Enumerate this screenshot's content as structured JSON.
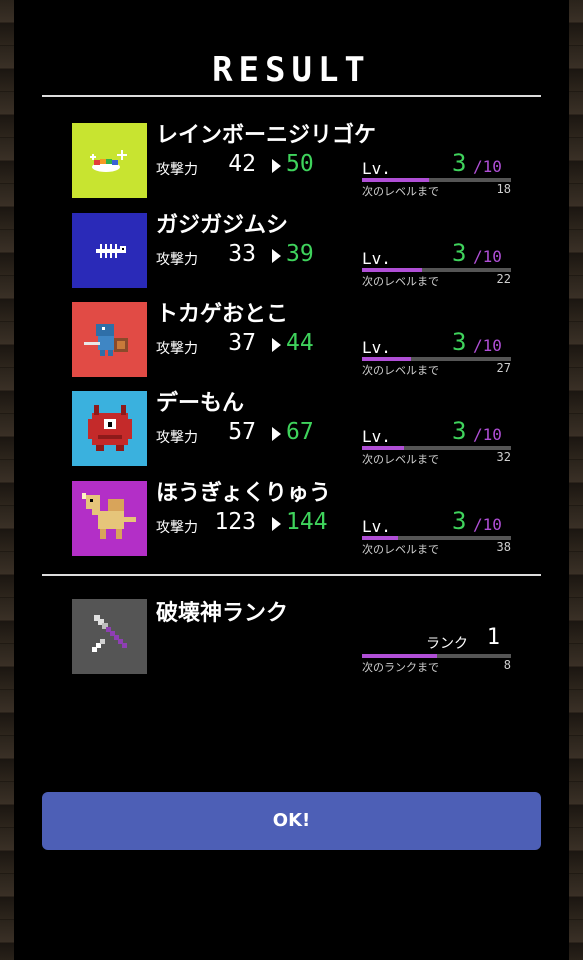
{
  "header": {
    "title": "RESULT"
  },
  "labels": {
    "attack": "攻撃力",
    "level": "Lv.",
    "next_level": "次のレベルまで",
    "rank": "ランク",
    "next_rank": "次のランクまで"
  },
  "monsters": [
    {
      "name": "レインボーニジリゴケ",
      "attack_before": "42",
      "attack_after": "50",
      "level": "3",
      "level_max": "/10",
      "to_next": "18",
      "progress": 0.45,
      "bg": "#c8e430"
    },
    {
      "name": "ガジガジムシ",
      "attack_before": "33",
      "attack_after": "39",
      "level": "3",
      "level_max": "/10",
      "to_next": "22",
      "progress": 0.4,
      "bg": "#2a2ab8"
    },
    {
      "name": "トカゲおとこ",
      "attack_before": "37",
      "attack_after": "44",
      "level": "3",
      "level_max": "/10",
      "to_next": "27",
      "progress": 0.33,
      "bg": "#e14b45"
    },
    {
      "name": "デーもん",
      "attack_before": "57",
      "attack_after": "67",
      "level": "3",
      "level_max": "/10",
      "to_next": "32",
      "progress": 0.28,
      "bg": "#3ab1de"
    },
    {
      "name": "ほうぎょくりゅう",
      "attack_before": "123",
      "attack_after": "144",
      "level": "3",
      "level_max": "/10",
      "to_next": "38",
      "progress": 0.24,
      "bg": "#b32fc7"
    }
  ],
  "rank": {
    "title": "破壊神ランク",
    "value": "1",
    "to_next": "8",
    "progress": 0.5,
    "bg": "#555555"
  },
  "ok_button": {
    "label": "OK!"
  },
  "colors": {
    "accent_green": "#3fd35c",
    "accent_purple": "#b04fd6",
    "button_blue": "#4d5fb6"
  }
}
